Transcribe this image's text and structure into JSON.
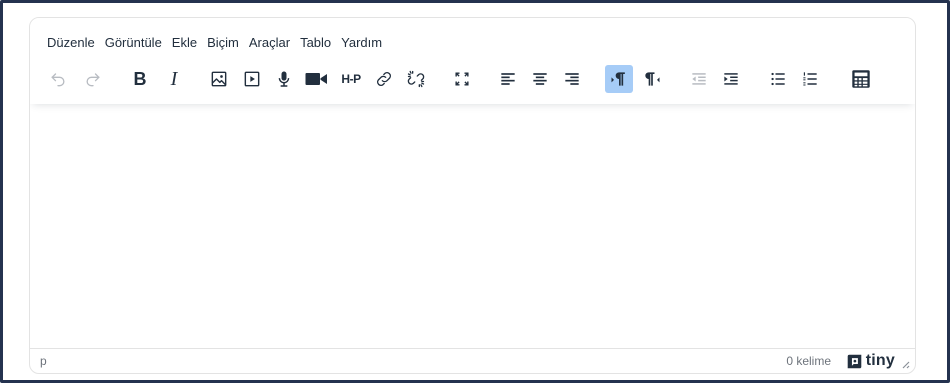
{
  "menubar": {
    "items": [
      "Düzenle",
      "Görüntüle",
      "Ekle",
      "Biçim",
      "Araçlar",
      "Tablo",
      "Yardım"
    ]
  },
  "toolbar": {
    "buttons": [
      {
        "icon": "undo-icon",
        "state": "disabled"
      },
      {
        "icon": "redo-icon",
        "state": "disabled"
      },
      {
        "icon": "bold-icon",
        "label": "B"
      },
      {
        "icon": "italic-icon",
        "label": "I"
      },
      {
        "icon": "image-icon"
      },
      {
        "icon": "media-icon"
      },
      {
        "icon": "microphone-icon"
      },
      {
        "icon": "video-camera-icon"
      },
      {
        "icon": "h5p-icon",
        "label": "H-P"
      },
      {
        "icon": "link-icon"
      },
      {
        "icon": "unlink-icon"
      },
      {
        "icon": "fullscreen-icon"
      },
      {
        "icon": "align-left-icon"
      },
      {
        "icon": "align-center-icon"
      },
      {
        "icon": "align-right-icon"
      },
      {
        "icon": "ltr-icon",
        "state": "active"
      },
      {
        "icon": "rtl-icon"
      },
      {
        "icon": "outdent-icon",
        "state": "disabled"
      },
      {
        "icon": "indent-icon"
      },
      {
        "icon": "bullet-list-icon"
      },
      {
        "icon": "numbered-list-icon"
      },
      {
        "icon": "calculator-icon"
      }
    ]
  },
  "statusbar": {
    "path": "p",
    "wordcount": "0 kelime",
    "brand": "tiny"
  },
  "colors": {
    "frame_border": "#24324f",
    "icon": "#222f3e",
    "icon_disabled": "#b8bcc2",
    "active_bg": "#a6ccf7",
    "border": "#e3e3e3"
  }
}
